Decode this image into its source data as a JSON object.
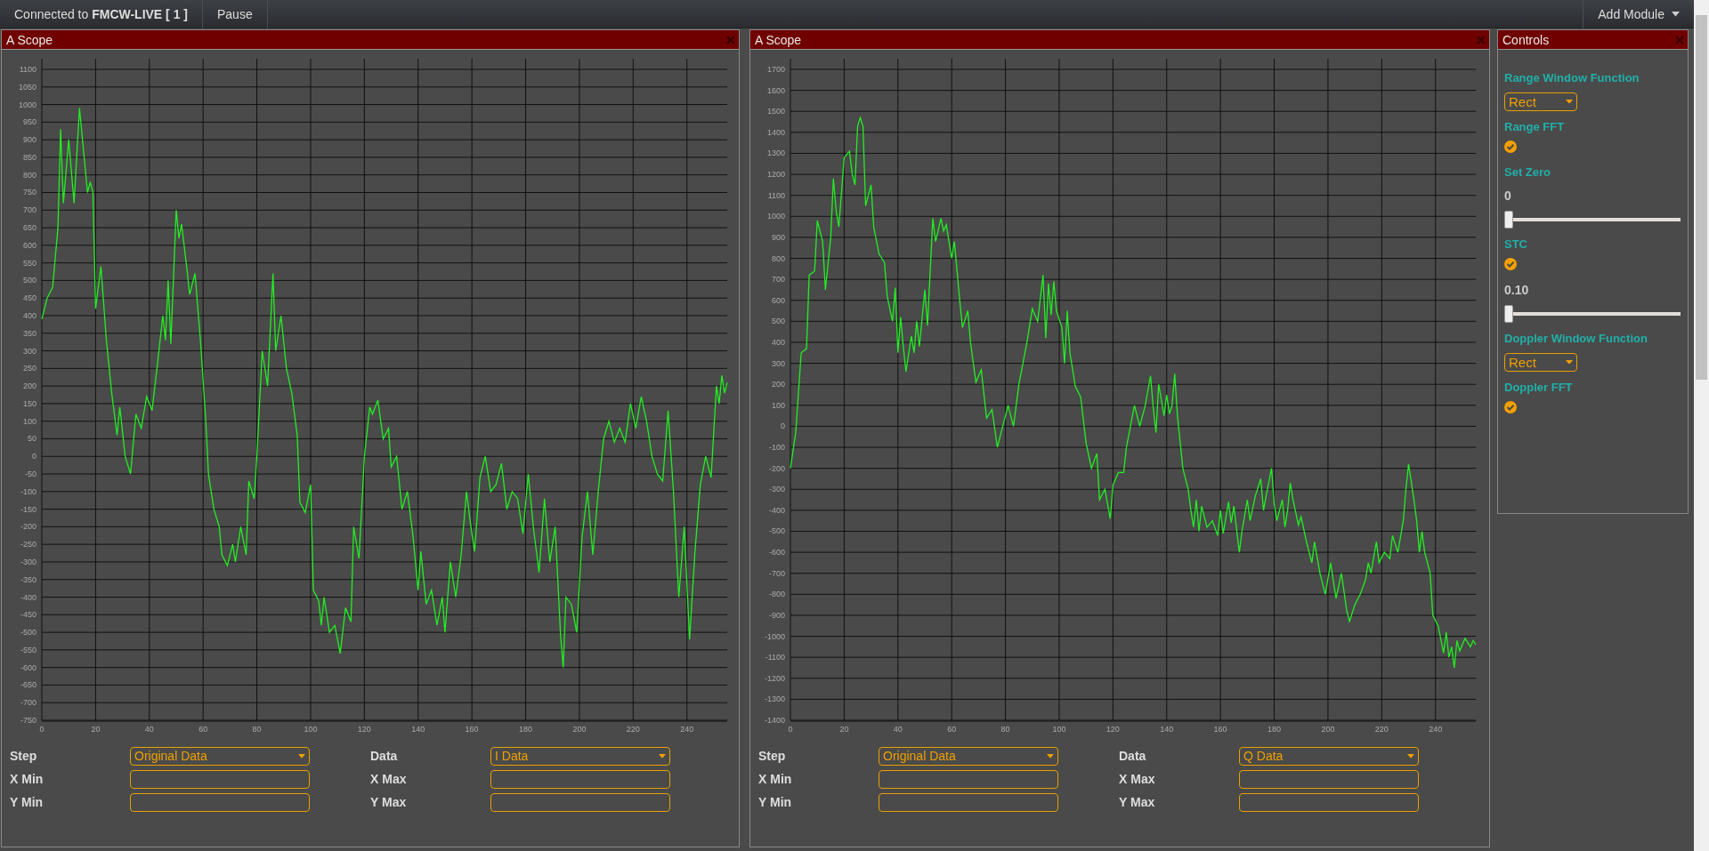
{
  "toolbar": {
    "connection": "Connected to **FMCW-LIVE [ 1 ]**",
    "pause": "Pause",
    "add_module": "Add Module"
  },
  "scopes": [
    {
      "title": "A Scope",
      "chart_data": {
        "type": "line",
        "grid": true,
        "xlim": [
          0,
          255
        ],
        "ylim": [
          -750,
          1100
        ],
        "xticks": [
          0,
          20,
          40,
          60,
          80,
          100,
          120,
          140,
          160,
          180,
          200,
          220,
          240
        ],
        "yticks": [
          -750,
          -700,
          -650,
          -600,
          -550,
          -500,
          -450,
          -400,
          -350,
          -300,
          -250,
          -200,
          -150,
          -100,
          -50,
          0,
          50,
          100,
          150,
          200,
          250,
          300,
          350,
          400,
          450,
          500,
          550,
          600,
          650,
          700,
          750,
          800,
          850,
          900,
          950,
          1000,
          1050,
          1100
        ],
        "x": [
          0,
          2,
          4,
          6,
          7,
          8,
          10,
          12,
          14,
          16,
          17,
          18,
          19,
          20,
          22,
          24,
          26,
          28,
          29,
          31,
          33,
          35,
          37,
          39,
          41,
          43,
          45,
          46,
          47,
          48,
          50,
          51,
          52,
          54,
          55,
          57,
          59,
          61,
          62,
          64,
          66,
          67,
          69,
          71,
          72,
          74,
          76,
          77,
          79,
          80,
          82,
          84,
          86,
          87,
          89,
          91,
          93,
          95,
          96,
          98,
          100,
          101,
          103,
          104,
          105,
          107,
          109,
          111,
          113,
          115,
          116,
          118,
          120,
          122,
          123,
          125,
          127,
          129,
          130,
          132,
          134,
          136,
          138,
          140,
          141,
          143,
          145,
          147,
          149,
          150,
          152,
          154,
          156,
          158,
          160,
          161,
          163,
          165,
          167,
          169,
          171,
          173,
          175,
          177,
          179,
          181,
          183,
          185,
          187,
          189,
          191,
          193,
          194,
          195,
          197,
          199,
          201,
          203,
          205,
          207,
          209,
          211,
          213,
          215,
          217,
          219,
          221,
          223,
          225,
          227,
          229,
          231,
          233,
          235,
          237,
          239,
          241,
          243,
          245,
          247,
          249,
          251,
          252,
          253,
          254,
          255
        ],
        "values": [
          390,
          450,
          480,
          650,
          930,
          720,
          900,
          720,
          990,
          830,
          750,
          780,
          750,
          420,
          540,
          330,
          180,
          60,
          140,
          0,
          -50,
          120,
          80,
          170,
          130,
          260,
          400,
          330,
          500,
          320,
          700,
          620,
          660,
          530,
          460,
          520,
          330,
          100,
          -50,
          -150,
          -200,
          -280,
          -310,
          -250,
          -300,
          -200,
          -280,
          -70,
          -120,
          0,
          300,
          200,
          520,
          300,
          400,
          250,
          180,
          60,
          -130,
          -160,
          -80,
          -380,
          -410,
          -480,
          -400,
          -500,
          -480,
          -560,
          -430,
          -470,
          -200,
          -290,
          0,
          140,
          120,
          160,
          50,
          80,
          -30,
          0,
          -150,
          -100,
          -220,
          -380,
          -270,
          -420,
          -380,
          -480,
          -400,
          -500,
          -300,
          -400,
          -280,
          -100,
          -220,
          -270,
          -60,
          0,
          -100,
          -80,
          -20,
          -150,
          -100,
          -120,
          -220,
          -50,
          -210,
          -330,
          -120,
          -300,
          -200,
          -510,
          -600,
          -400,
          -420,
          -500,
          -230,
          -100,
          -280,
          -100,
          50,
          100,
          40,
          80,
          40,
          150,
          80,
          170,
          100,
          0,
          -50,
          -70,
          130,
          -100,
          -400,
          -200,
          -520,
          -270,
          -80,
          0,
          -60,
          200,
          150,
          230,
          180,
          210
        ]
      },
      "form": {
        "step_label": "Step",
        "step_value": "Original Data",
        "data_label": "Data",
        "data_value": "I Data",
        "x_min_label": "X Min",
        "x_max_label": "X Max",
        "y_min_label": "Y Min",
        "y_max_label": "Y Max"
      }
    },
    {
      "title": "A Scope",
      "chart_data": {
        "type": "line",
        "grid": true,
        "xlim": [
          0,
          255
        ],
        "ylim": [
          -1400,
          1700
        ],
        "xticks": [
          0,
          20,
          40,
          60,
          80,
          100,
          120,
          140,
          160,
          180,
          200,
          220,
          240
        ],
        "yticks": [
          -1400,
          -1300,
          -1200,
          -1100,
          -1000,
          -900,
          -800,
          -700,
          -600,
          -500,
          -400,
          -300,
          -200,
          -100,
          0,
          100,
          200,
          300,
          400,
          500,
          600,
          700,
          800,
          900,
          1000,
          1100,
          1200,
          1300,
          1400,
          1500,
          1600,
          1700
        ],
        "x": [
          0,
          2,
          4,
          6,
          7,
          9,
          10,
          12,
          13,
          15,
          16,
          17,
          18,
          20,
          22,
          23,
          24,
          25,
          26,
          27,
          28,
          30,
          31,
          33,
          35,
          36,
          38,
          39,
          40,
          41,
          42,
          43,
          45,
          46,
          47,
          48,
          50,
          51,
          53,
          54,
          56,
          57,
          58,
          60,
          61,
          63,
          64,
          66,
          67,
          69,
          71,
          73,
          75,
          77,
          79,
          81,
          83,
          85,
          88,
          90,
          92,
          94,
          95,
          96,
          97,
          98,
          99,
          101,
          102,
          103,
          104,
          106,
          108,
          110,
          112,
          114,
          115,
          117,
          119,
          120,
          122,
          124,
          125,
          128,
          130,
          132,
          134,
          135,
          136,
          137,
          139,
          140,
          141,
          142,
          143,
          144,
          146,
          148,
          149,
          150,
          151,
          152,
          153,
          155,
          157,
          159,
          160,
          161,
          163,
          164,
          165,
          167,
          168,
          170,
          171,
          173,
          175,
          176,
          177,
          179,
          180,
          181,
          183,
          184,
          185,
          186,
          187,
          189,
          190,
          192,
          194,
          195,
          197,
          199,
          201,
          203,
          205,
          207,
          208,
          210,
          212,
          214,
          215,
          216,
          218,
          219,
          221,
          223,
          224,
          226,
          228,
          229,
          230,
          232,
          233,
          234,
          235,
          236,
          238,
          239,
          241,
          243,
          244,
          245,
          246,
          247,
          248,
          249,
          251,
          253,
          254,
          255
        ],
        "values": [
          -200,
          -30,
          350,
          370,
          720,
          740,
          980,
          880,
          650,
          900,
          1180,
          1030,
          950,
          1280,
          1310,
          1200,
          1150,
          1430,
          1470,
          1430,
          1050,
          1150,
          950,
          820,
          780,
          620,
          500,
          660,
          350,
          520,
          380,
          260,
          430,
          350,
          500,
          380,
          650,
          480,
          990,
          880,
          990,
          930,
          960,
          800,
          880,
          600,
          470,
          550,
          400,
          210,
          270,
          40,
          80,
          -100,
          0,
          100,
          0,
          200,
          400,
          560,
          500,
          720,
          420,
          680,
          530,
          690,
          550,
          470,
          300,
          550,
          350,
          190,
          140,
          -80,
          -200,
          -130,
          -350,
          -300,
          -440,
          -280,
          -220,
          -220,
          -100,
          100,
          0,
          100,
          240,
          90,
          -30,
          200,
          50,
          150,
          60,
          100,
          250,
          50,
          -200,
          -300,
          -400,
          -480,
          -350,
          -500,
          -380,
          -480,
          -450,
          -520,
          -400,
          -510,
          -360,
          -460,
          -380,
          -600,
          -500,
          -350,
          -450,
          -330,
          -250,
          -400,
          -330,
          -200,
          -370,
          -450,
          -350,
          -480,
          -400,
          -270,
          -350,
          -470,
          -430,
          -550,
          -650,
          -550,
          -700,
          -800,
          -650,
          -820,
          -700,
          -880,
          -930,
          -850,
          -800,
          -730,
          -650,
          -700,
          -550,
          -650,
          -600,
          -630,
          -520,
          -600,
          -450,
          -300,
          -180,
          -350,
          -450,
          -600,
          -500,
          -600,
          -700,
          -900,
          -950,
          -1080,
          -980,
          -1100,
          -1050,
          -1150,
          -1020,
          -1070,
          -1010,
          -1050,
          -1020,
          -1040
        ]
      },
      "form": {
        "step_label": "Step",
        "step_value": "Original Data",
        "data_label": "Data",
        "data_value": "Q Data",
        "x_min_label": "X Min",
        "x_max_label": "X Max",
        "y_min_label": "Y Min",
        "y_max_label": "Y Max"
      }
    }
  ],
  "controls": {
    "title": "Controls",
    "items": [
      {
        "kind": "select",
        "label": "Range Window Function",
        "value": "Rect"
      },
      {
        "kind": "check",
        "label": "Range FFT",
        "checked": true
      },
      {
        "kind": "slider",
        "label": "Set Zero",
        "reading": "0",
        "level": 0
      },
      {
        "kind": "check",
        "label": "STC",
        "checked": true
      },
      {
        "kind": "slider",
        "reading": "0.10",
        "level": 0
      },
      {
        "kind": "select",
        "label": "Doppler Window Function",
        "value": "Rect"
      },
      {
        "kind": "check",
        "label": "Doppler FFT",
        "checked": true
      }
    ]
  }
}
